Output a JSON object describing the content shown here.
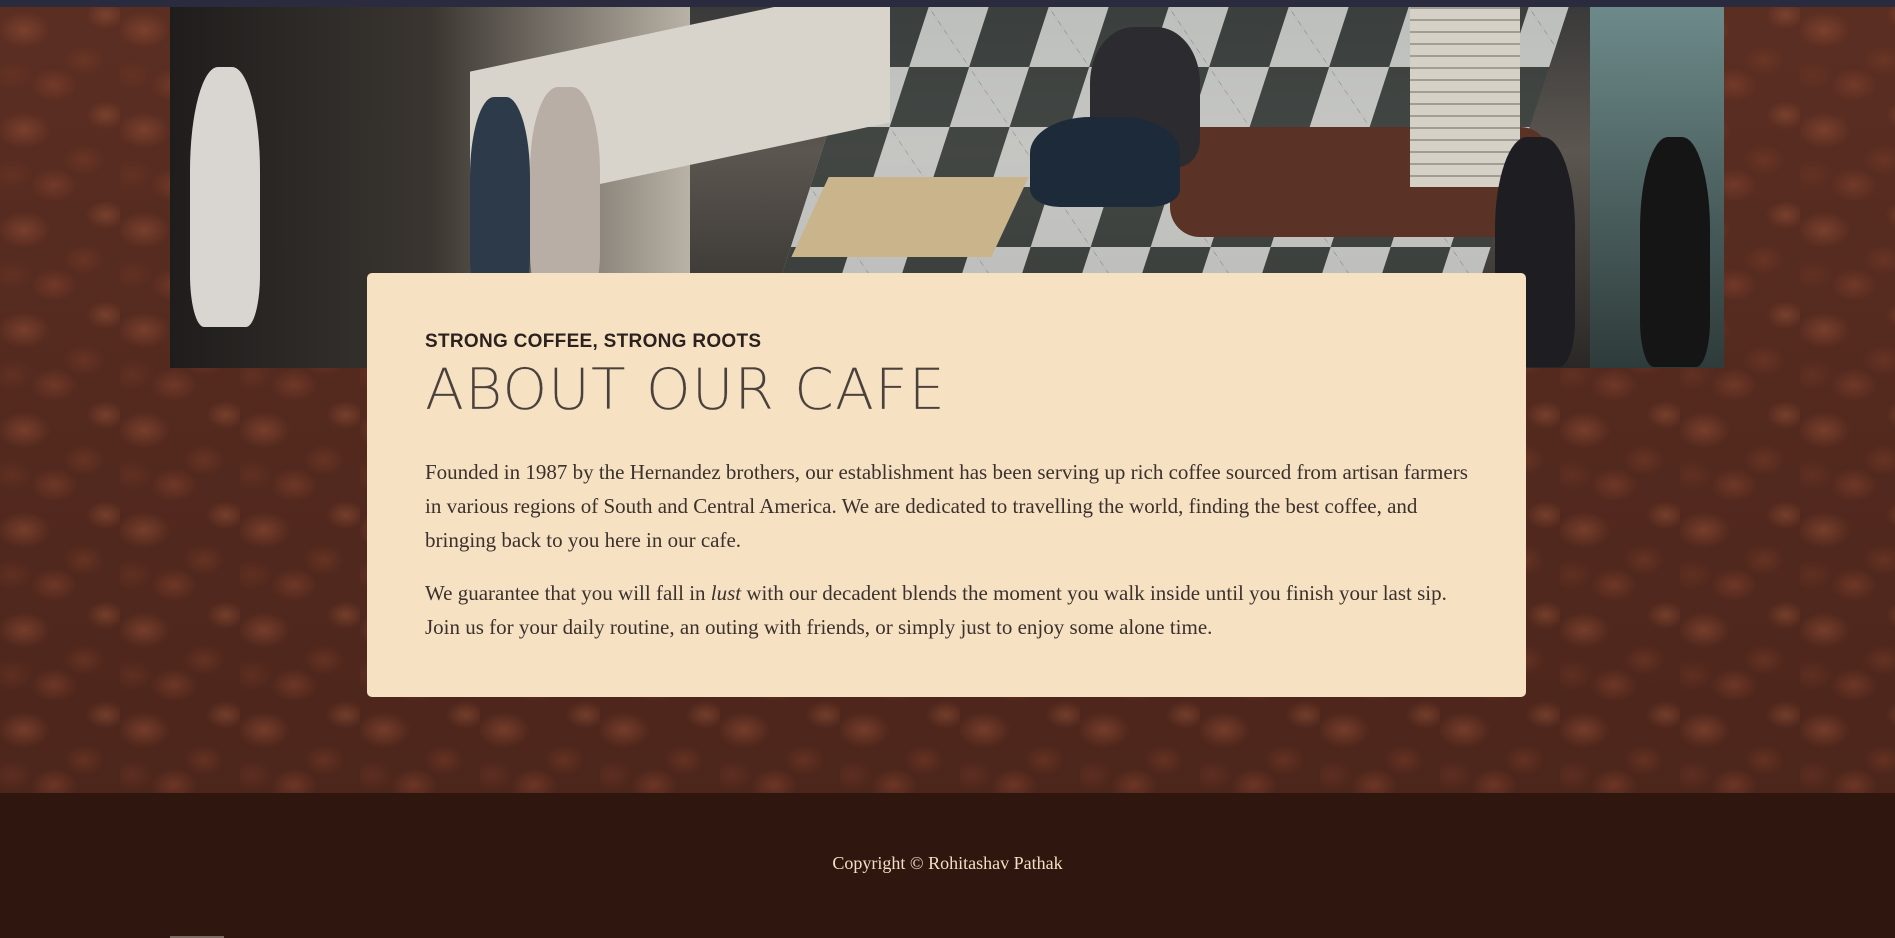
{
  "hero": {
    "image_alt": "cafe-interior-photo"
  },
  "about": {
    "subtitle": "STRONG COFFEE, STRONG ROOTS",
    "title": "ABOUT OUR CAFE",
    "paragraph1": "Founded in 1987 by the Hernandez brothers, our establishment has been serving up rich coffee sourced from artisan farmers in various regions of South and Central America. We are dedicated to travelling the world, finding the best coffee, and bringing back to you here in our cafe.",
    "paragraph2_before": "We guarantee that you will fall in ",
    "paragraph2_emphasis": "lust",
    "paragraph2_after": " with our decadent blends the moment you walk inside until you finish your last sip. Join us for your daily routine, an outing with friends, or simply just to enjoy some alone time."
  },
  "footer": {
    "copyright": "Copyright © Rohitashav Pathak"
  },
  "colors": {
    "card_background": "#f7e1c3",
    "footer_background": "#2f160f",
    "page_background": "#4a241a",
    "footer_text": "#f3dfc3"
  }
}
